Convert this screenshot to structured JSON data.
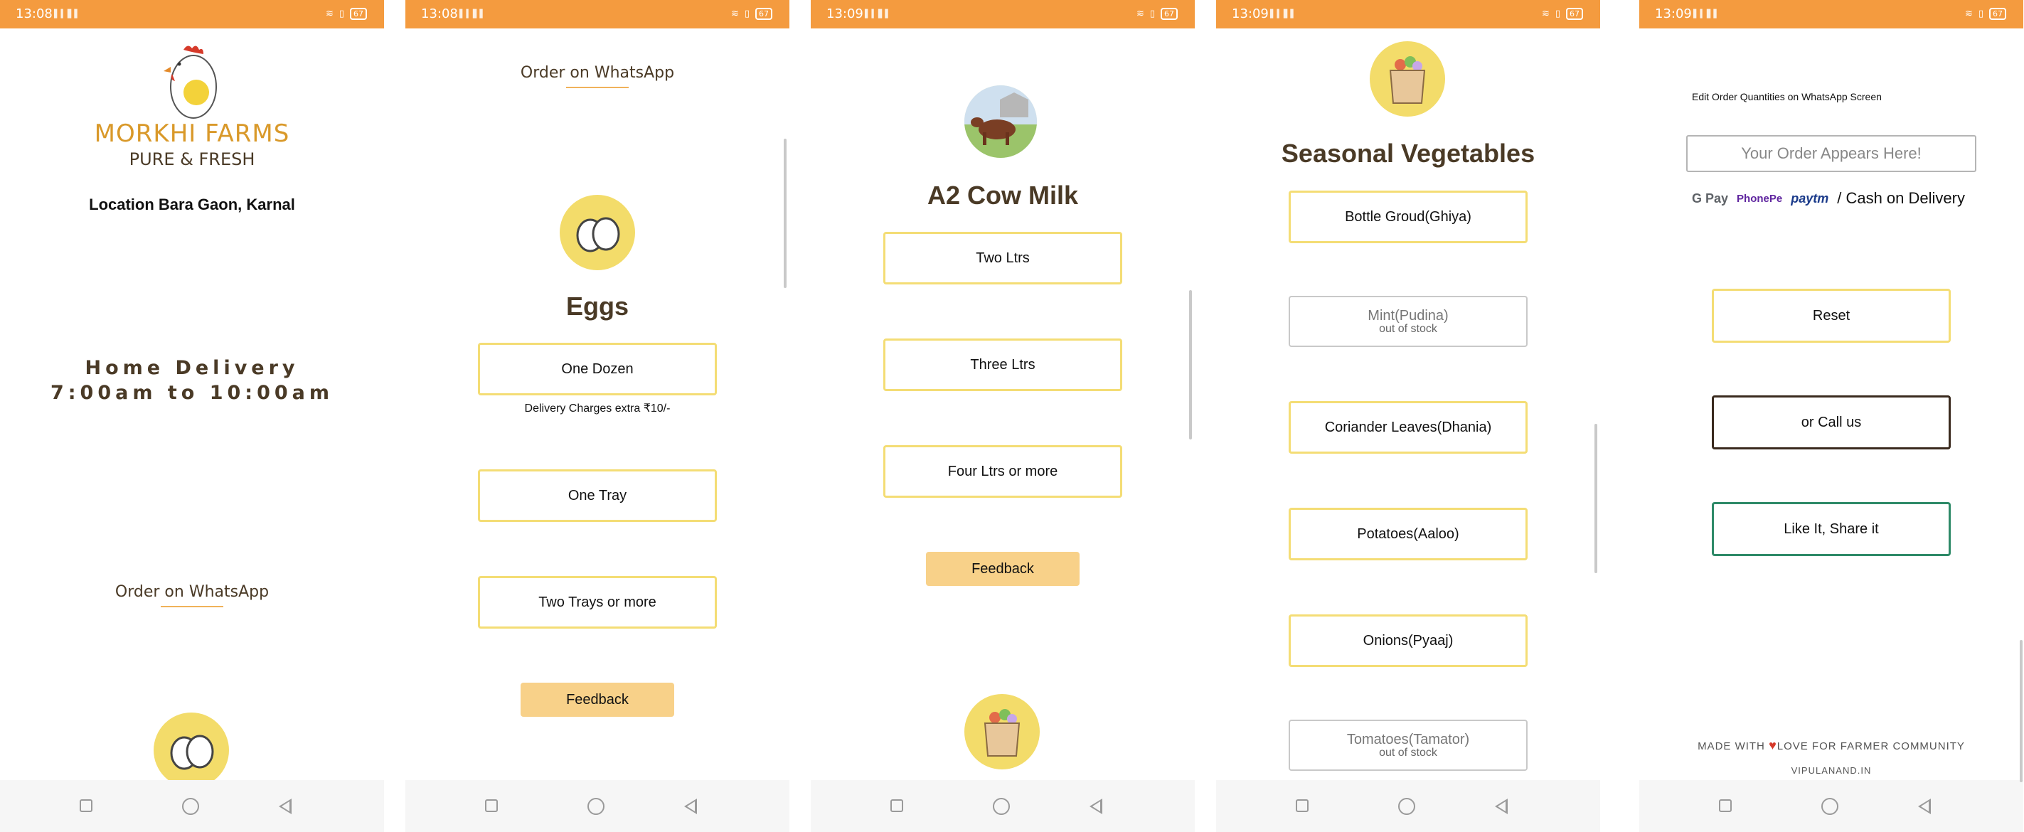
{
  "status": {
    "times": [
      "13:08",
      "13:08",
      "13:09",
      "13:09",
      "13:09"
    ],
    "battery": "67"
  },
  "screen1": {
    "brand_name": "MORKHI FARMS",
    "tagline": "PURE & FRESH",
    "location": "Location Bara Gaon, Karnal",
    "delivery_line1": "Home Delivery",
    "delivery_line2": "7:00am to 10:00am",
    "whatsapp_link": "Order on WhatsApp"
  },
  "screen2": {
    "whatsapp_link": "Order on WhatsApp",
    "title": "Eggs",
    "options": [
      "One Dozen",
      "One Tray",
      "Two Trays or more"
    ],
    "delivery_note": "Delivery Charges extra ₹10/-",
    "feedback": "Feedback"
  },
  "screen3": {
    "title": "A2 Cow Milk",
    "options": [
      "Two Ltrs",
      "Three Ltrs",
      "Four Ltrs or more"
    ],
    "feedback": "Feedback"
  },
  "screen4": {
    "title": "Seasonal Vegetables",
    "items": [
      {
        "label": "Bottle Groud(Ghiya)",
        "status": ""
      },
      {
        "label": "Mint(Pudina)",
        "status": "out of stock"
      },
      {
        "label": "Coriander Leaves(Dhania)",
        "status": ""
      },
      {
        "label": "Potatoes(Aaloo)",
        "status": ""
      },
      {
        "label": "Onions(Pyaaj)",
        "status": ""
      },
      {
        "label": "Tomatoes(Tamator)",
        "status": "out of stock"
      }
    ]
  },
  "screen5": {
    "hint": "Edit Order Quantities on WhatsApp Screen",
    "order_placeholder": "Your Order Appears Here!",
    "payment_gpay": "G Pay",
    "payment_phonepe": "PhonePe",
    "payment_paytm": "paytm",
    "payment_text": "/ Cash on Delivery",
    "reset": "Reset",
    "call": "or Call us",
    "share": "Like It, Share it",
    "footer_made": "MADE WITH",
    "footer_love": "LOVE FOR FARMER COMMUNITY",
    "footer_site": "VIPULANAND.IN"
  },
  "colors": {
    "status_bar": "#f49b3f",
    "button_border": "#f4dd75",
    "feedback_bg": "#f8d189",
    "icon_circle": "#f3dc6a",
    "brand_text": "#d9992a",
    "heading_text": "#4a3a26",
    "share_border": "#2e8a68",
    "call_border": "#3a2a1e",
    "heart": "#d63a2a"
  }
}
